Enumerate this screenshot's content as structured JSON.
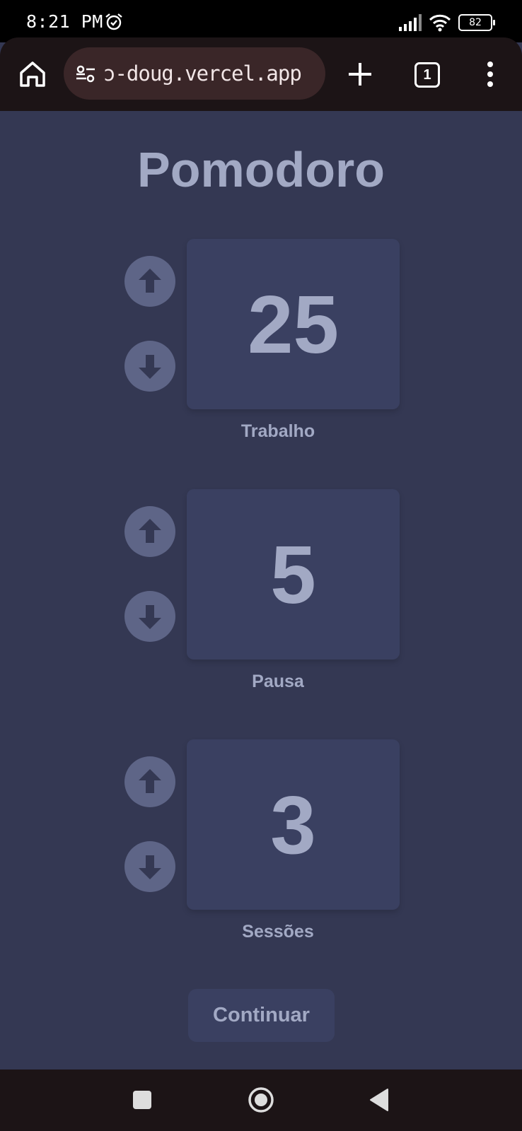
{
  "status_bar": {
    "time": "8:21 PM",
    "battery": "82",
    "icons": [
      "alarm-icon",
      "signal-icon",
      "wifi-icon",
      "battery-icon"
    ]
  },
  "browser": {
    "url": "ɔ-doug.vercel.app",
    "tab_count": "1",
    "icons": [
      "home-icon",
      "site-settings-icon",
      "plus-icon",
      "tab-switcher-icon",
      "more-vert-icon"
    ]
  },
  "page": {
    "title": "Pomodoro",
    "timers": [
      {
        "value": "25",
        "label": "Trabalho"
      },
      {
        "value": "5",
        "label": "Pausa"
      },
      {
        "value": "3",
        "label": "Sessões"
      }
    ],
    "continue_label": "Continuar"
  },
  "colors": {
    "background": "#343853",
    "card": "#3a4061",
    "button": "#5e6587",
    "text": "#a2a9c4"
  }
}
